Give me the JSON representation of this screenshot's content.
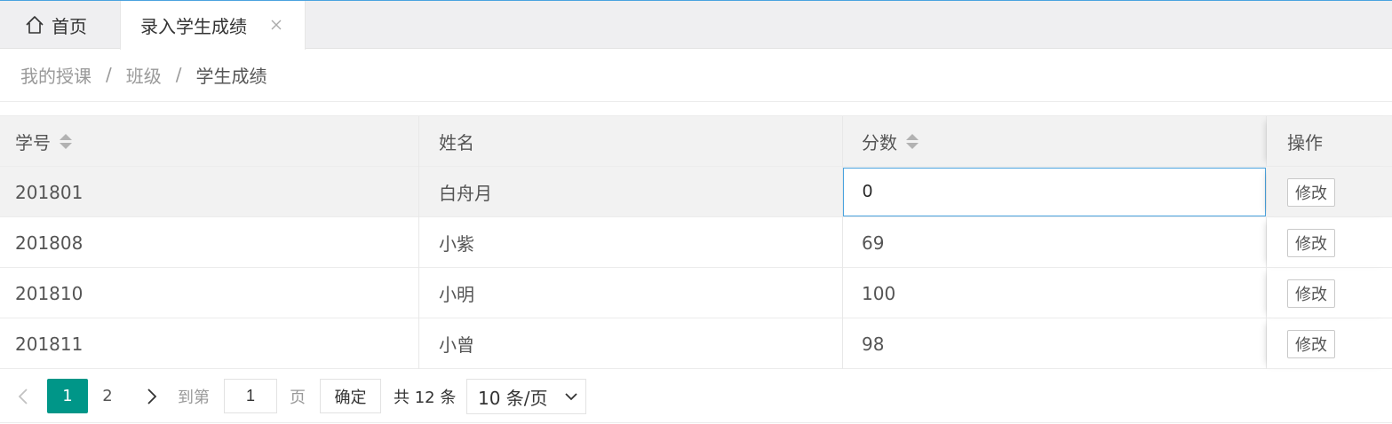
{
  "tabs": {
    "home_label": "首页",
    "active_label": "录入学生成绩"
  },
  "breadcrumb": {
    "items": [
      "我的授课",
      "班级",
      "学生成绩"
    ],
    "separator": "/"
  },
  "table": {
    "columns": [
      "学号",
      "姓名",
      "分数",
      "操作"
    ],
    "rows": [
      {
        "id": "201801",
        "name": "白舟月",
        "score": "0",
        "action": "修改"
      },
      {
        "id": "201808",
        "name": "小紫",
        "score": "69",
        "action": "修改"
      },
      {
        "id": "201810",
        "name": "小明",
        "score": "100",
        "action": "修改"
      },
      {
        "id": "201811",
        "name": "小曾",
        "score": "98",
        "action": "修改"
      }
    ]
  },
  "pagination": {
    "pages": [
      "1",
      "2"
    ],
    "current_page": "1",
    "goto_label": "到第",
    "goto_value": "1",
    "page_suffix": "页",
    "confirm_label": "确定",
    "total_label": "共 12 条",
    "page_size": "10 条/页"
  },
  "colors": {
    "accent": "#009688",
    "focus_border": "#4aa3df"
  }
}
